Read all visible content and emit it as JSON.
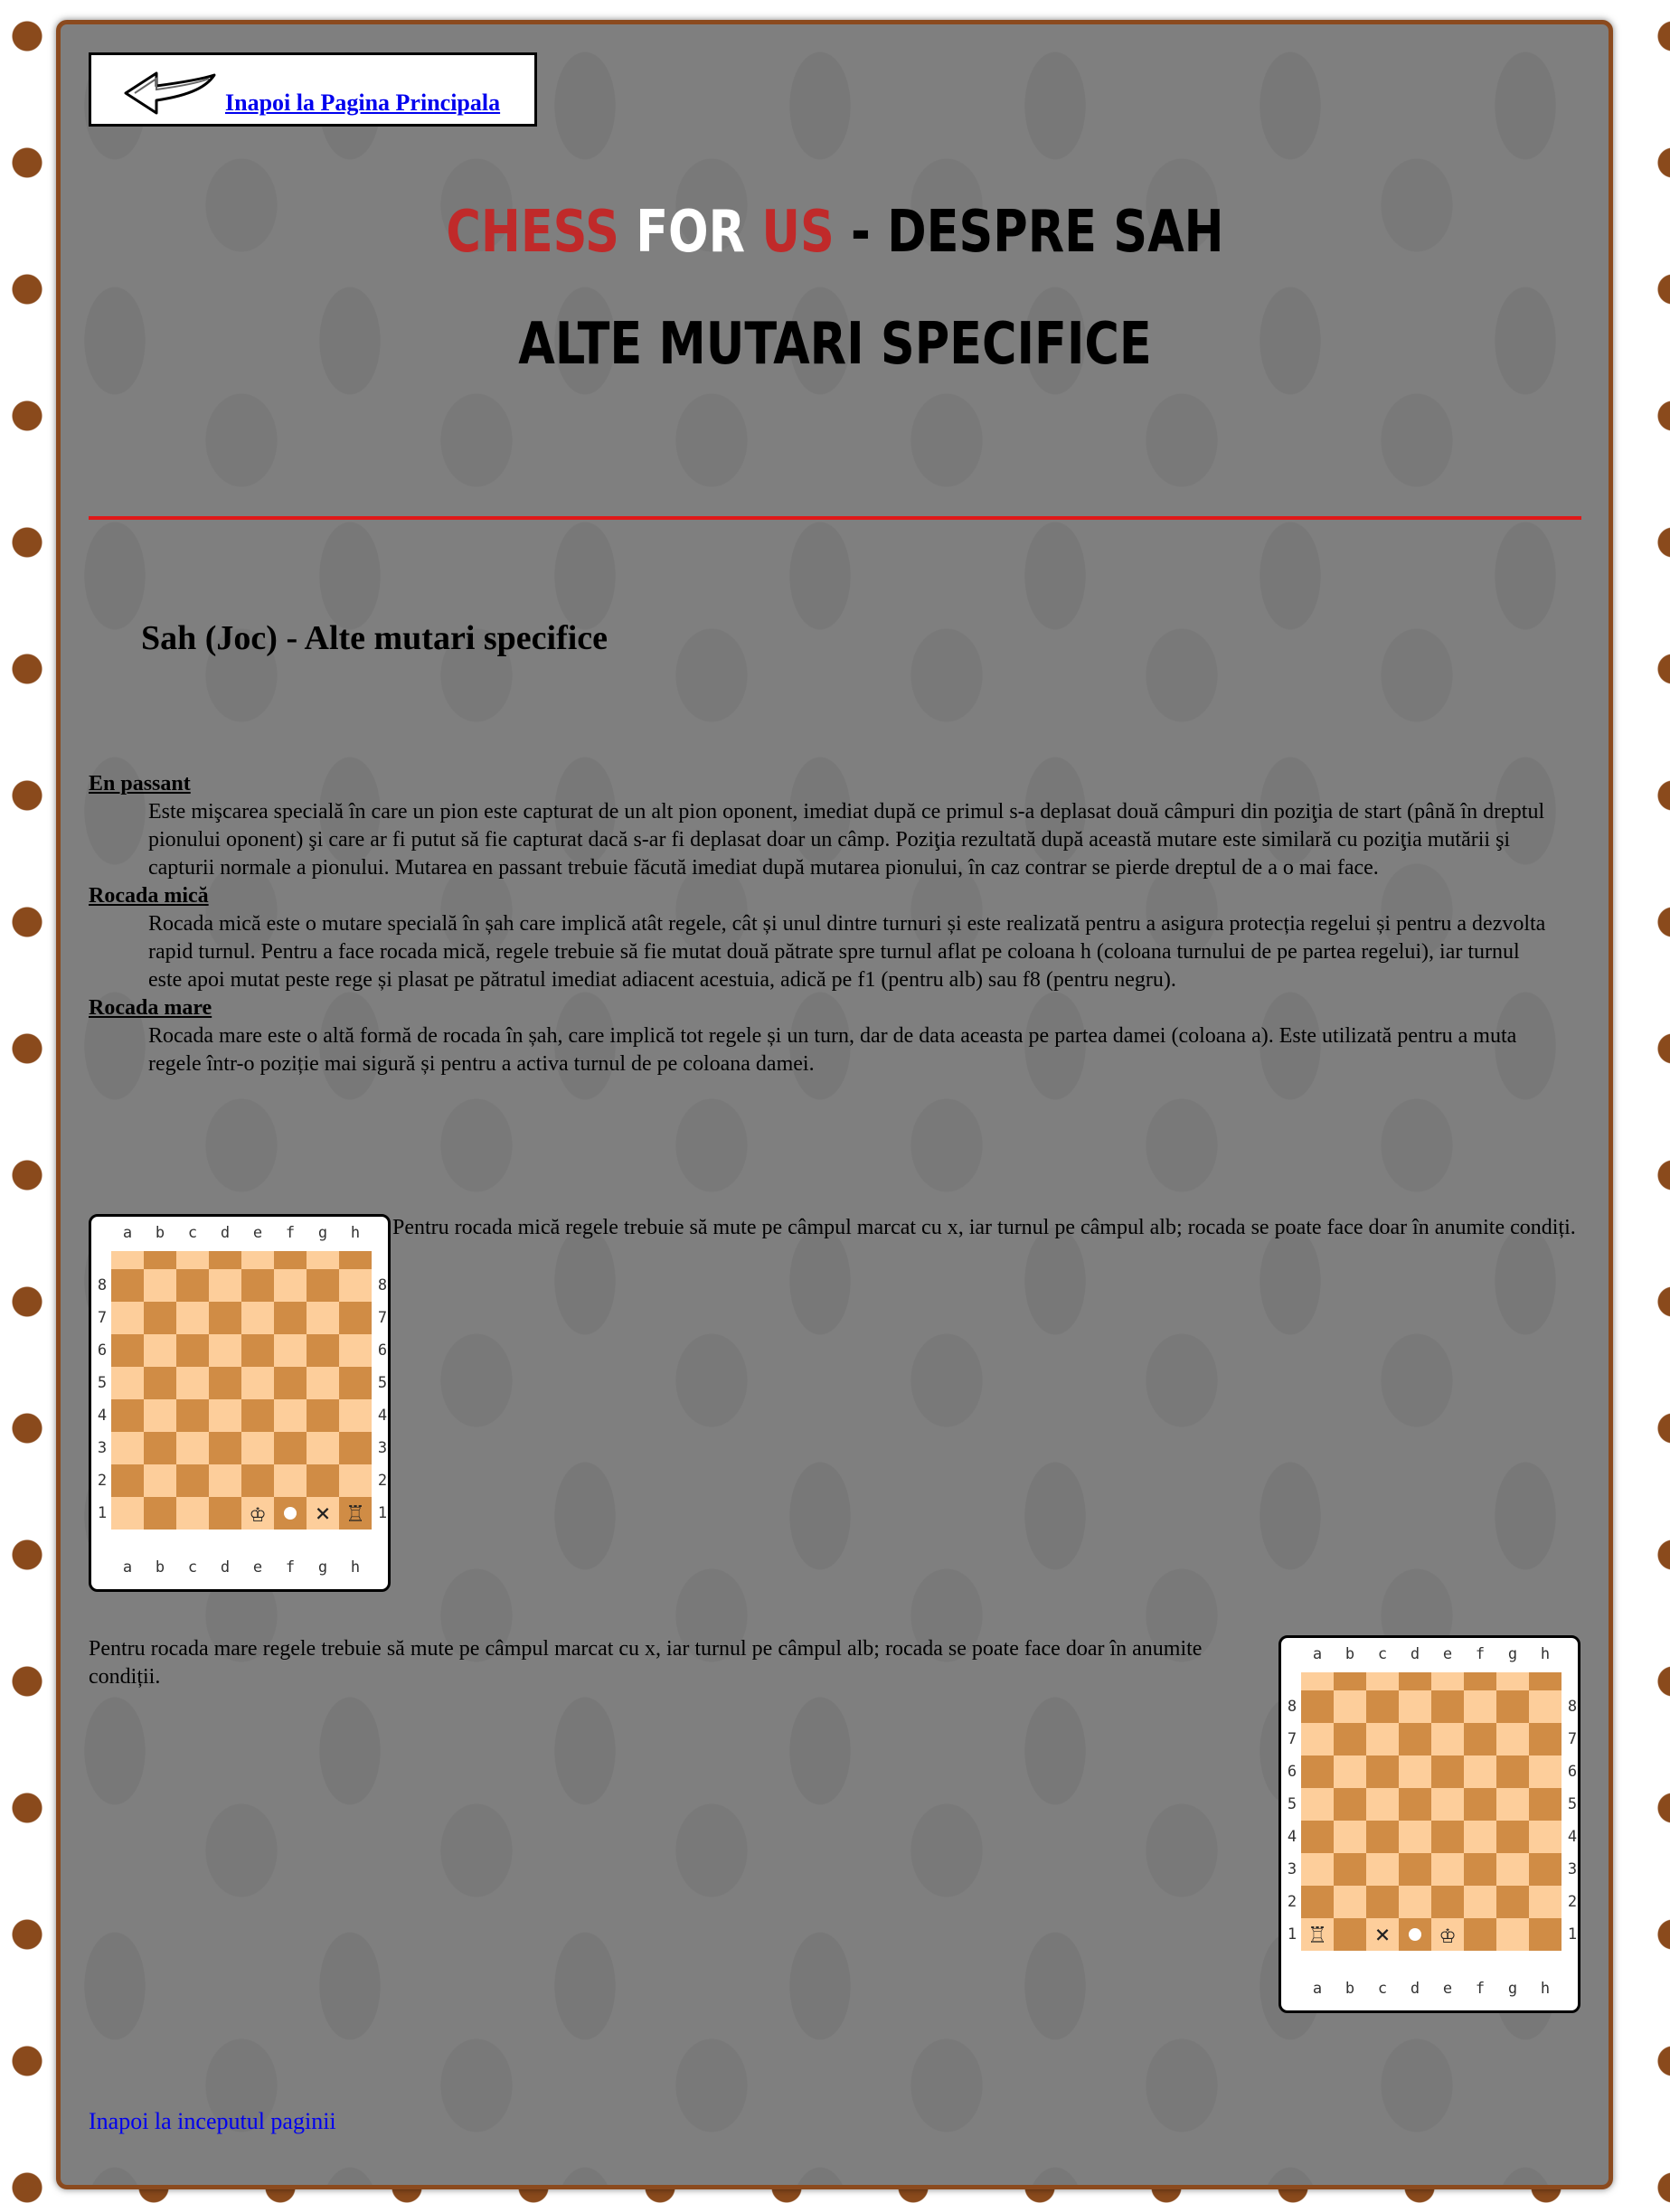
{
  "back_link": {
    "label": "Inapoi la Pagina Principala",
    "icon": "back-arrow-icon"
  },
  "header": {
    "brand_chess": "Chess",
    "brand_for": "for",
    "brand_us": "Us",
    "brand_rest": "- Despre Sah",
    "subtitle": "Alte mutari specifice"
  },
  "colors": {
    "accent_red": "#c02a2a",
    "rule_red": "#e01818",
    "frame_brown": "#8b4a1e",
    "panel_gray": "#7f7f7f",
    "link_blue": "#0000ee"
  },
  "section": {
    "heading": "Sah (Joc) - Alte mutari specifice",
    "terms": [
      {
        "term": "En passant",
        "definition": "Este mişcarea specială în care un pion este capturat de un alt pion oponent, imediat după ce primul s-a deplasat două câmpuri din poziţia de start (până în dreptul pionului oponent) şi care ar fi putut să fie capturat dacă s-ar fi deplasat doar un câmp. Poziţia rezultată după această mutare este similară cu poziţia mutării şi capturii normale a pionului. Mutarea en passant trebuie făcută imediat după mutarea pionului, în caz contrar se pierde dreptul de a o mai face."
      },
      {
        "term": "Rocada mică",
        "definition": "Rocada mică este o mutare specială în șah care implică atât regele, cât și unul dintre turnuri și este realizată pentru a asigura protecția regelui și pentru a dezvolta rapid turnul. Pentru a face rocada mică, regele trebuie să fie mutat două pătrate spre turnul aflat pe coloana h (coloana turnului de pe partea regelui), iar turnul este apoi mutat peste rege și plasat pe pătratul imediat adiacent acestuia, adică pe f1 (pentru alb) sau f8 (pentru negru)."
      },
      {
        "term": "Rocada mare",
        "definition": "Rocada mare este o altă formă de rocada în șah, care implică tot regele și un turn, dar de data aceasta pe partea damei (coloana a). Este utilizată pentru a muta regele într-o poziție mai sigură și pentru a activa turnul de pe coloana damei."
      }
    ]
  },
  "board_files": [
    "a",
    "b",
    "c",
    "d",
    "e",
    "f",
    "g",
    "h"
  ],
  "board_ranks": [
    "8",
    "7",
    "6",
    "5",
    "4",
    "3",
    "2",
    "1"
  ],
  "board_small": {
    "caption": "Pentru rocada mică regele trebuie să mute pe câmpul marcat cu x, iar turnul pe câmpul alb; rocada se poate face doar în anumite condiți.",
    "rank1": {
      "e": "♔",
      "f": "dot",
      "g": "×",
      "h": "♖"
    }
  },
  "board_large": {
    "caption": "Pentru rocada mare regele trebuie să mute pe câmpul marcat cu x, iar turnul pe câmpul alb; rocada se poate face doar în anumite condiții.",
    "rank1": {
      "a": "♖",
      "c": "×",
      "d": "dot",
      "e": "♔"
    }
  },
  "bottom_link": {
    "label": "Inapoi la inceputul paginii"
  }
}
